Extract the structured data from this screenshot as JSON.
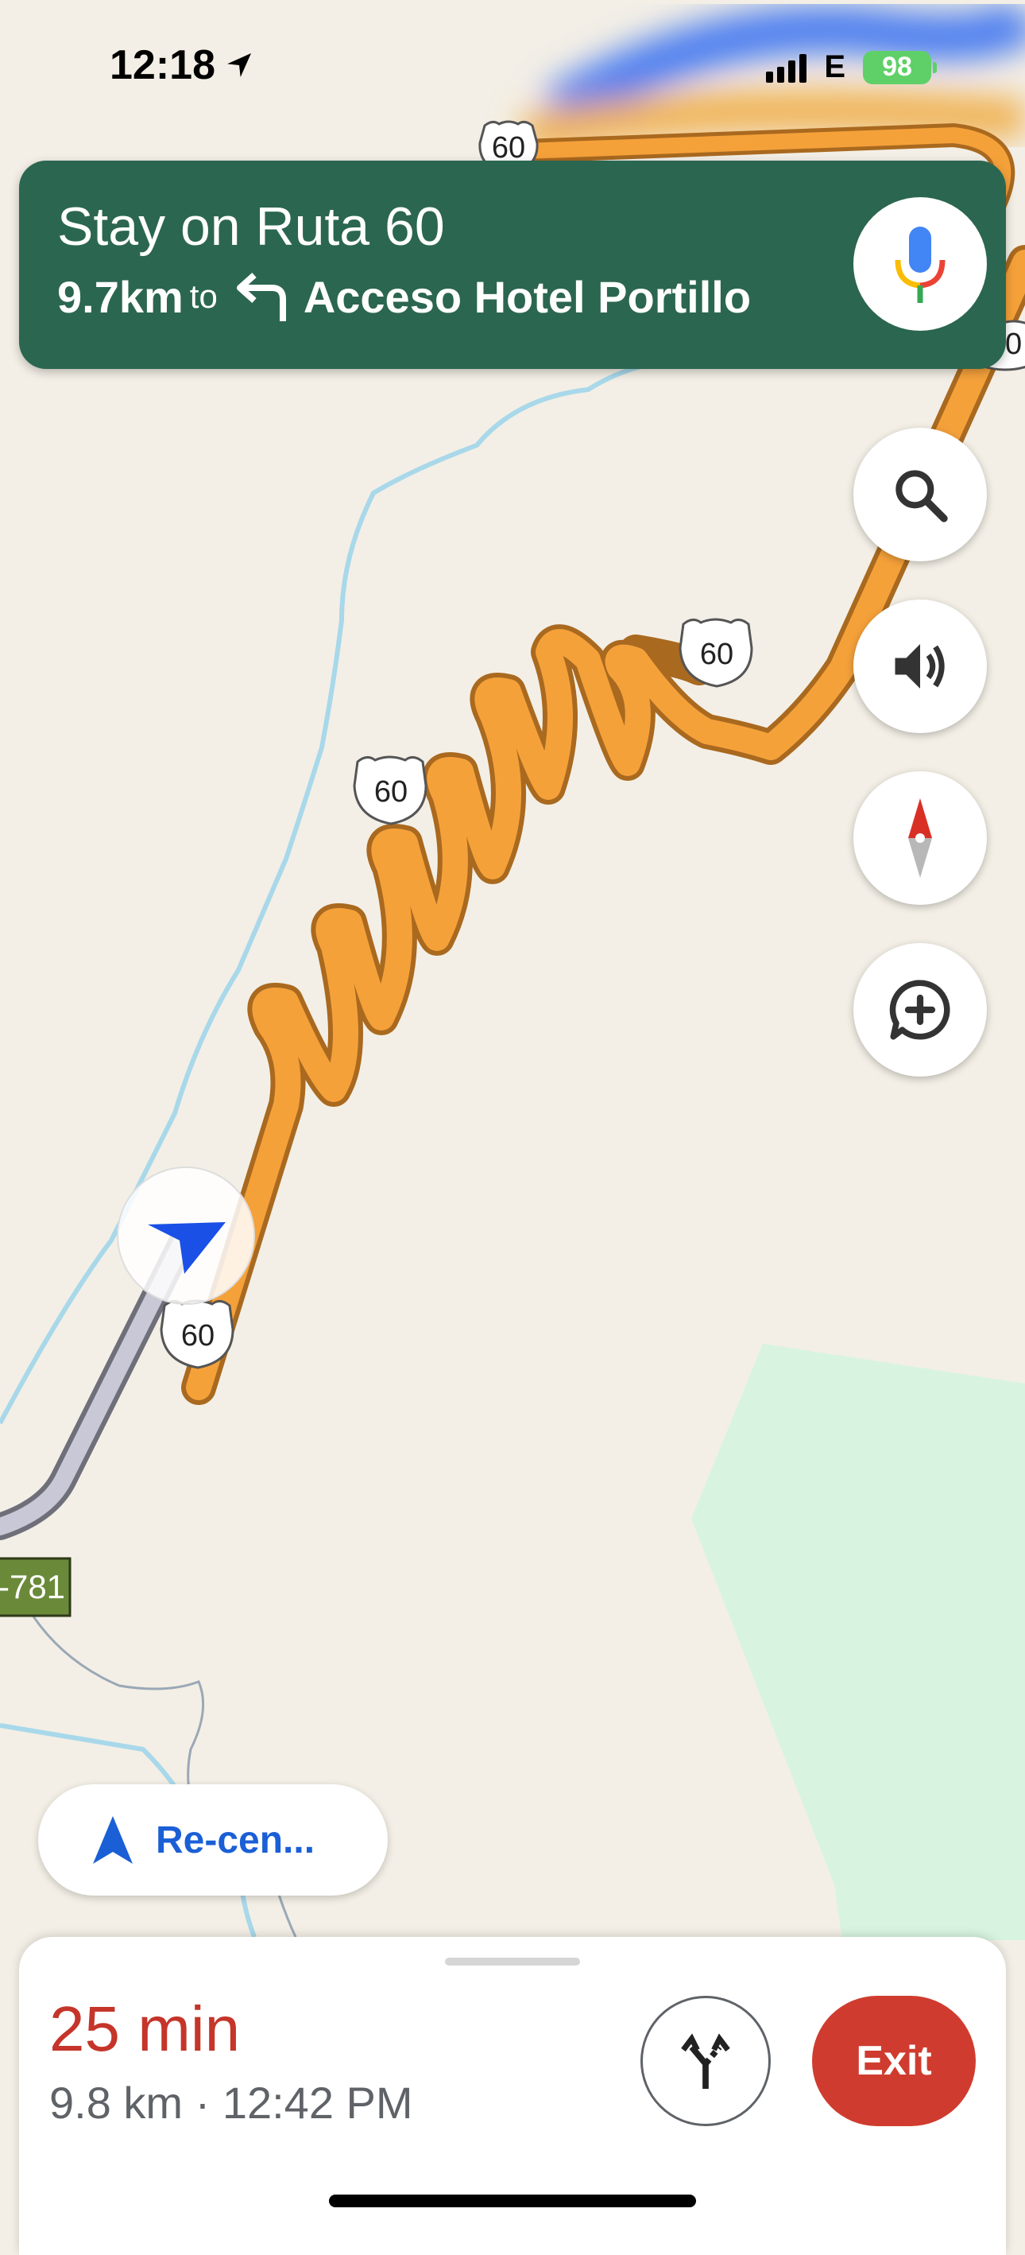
{
  "status_bar": {
    "time": "12:18",
    "carrier": "E",
    "battery": "98"
  },
  "navigation": {
    "instruction": "Stay on Ruta 60",
    "distance": "9.7km",
    "to_word": "to",
    "next_turn": "Acceso Hotel Portillo",
    "turn_direction": "left"
  },
  "map": {
    "route_shields": [
      "60",
      "60",
      "60",
      "60",
      "60"
    ],
    "road_marker": "-781",
    "route_color": "#f5a13a",
    "park_color": "#d8f4e0",
    "river_color": "#a8d8ea"
  },
  "controls": {
    "search_icon": "search-icon",
    "sound_icon": "volume-icon",
    "compass_icon": "compass-icon",
    "report_icon": "add-report-icon",
    "recenter_label": "Re-cen..."
  },
  "trip": {
    "eta_duration": "25 min",
    "details": "9.8 km · 12:42 PM",
    "exit_label": "Exit"
  }
}
